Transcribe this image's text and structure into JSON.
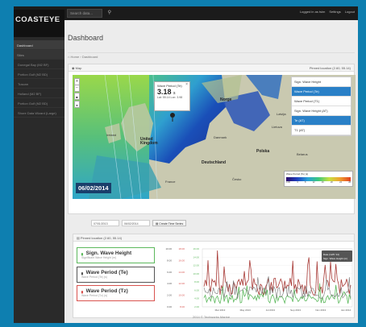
{
  "brand": {
    "name": "COASTEYE"
  },
  "topbar": {
    "search_placeholder": "Search data...",
    "user": "Logged in as tsim",
    "settings": "Settings",
    "logout": "Logout"
  },
  "sidebar": {
    "items": [
      {
        "label": "Dashboard",
        "active": true
      },
      {
        "label": "Sites",
        "active": false
      },
      {
        "label": "Donegal Bay (M2 BF)"
      },
      {
        "label": "Portion Gulf (M2 BD)"
      },
      {
        "label": "Tuscan"
      },
      {
        "label": "Holland (M2 BF)"
      },
      {
        "label": "Portion Gulf (M2 BD)"
      },
      {
        "label": "Shore Data Wizard (Large)"
      }
    ]
  },
  "page": {
    "title": "Dashboard",
    "breadcrumb_home": "Home",
    "breadcrumb_current": "Dashboard"
  },
  "map_panel": {
    "title": "Map",
    "right_label": "Pinned location (2.60, 55.14)",
    "zoom_in": "+",
    "zoom_out": "−",
    "popup": {
      "title": "Wave Period (Te)",
      "value": "3.18",
      "unit": "s",
      "lat_lon": "Lat: 55.14 Lon: 3.98"
    },
    "layers": [
      {
        "label": "Sign. Wave Height",
        "selected": false
      },
      {
        "label": "Wave Period (Te)",
        "selected": true
      },
      {
        "label": "Wave Period (T1)",
        "selected": false
      },
      {
        "label": "Sign. Wave Height (AT)",
        "selected": false
      },
      {
        "label": "Te (AT)",
        "selected": true
      },
      {
        "label": "T1 (AT)",
        "selected": false
      }
    ],
    "legend": {
      "title": "Wave Period (Te) [s]",
      "ticks": [
        "0.00",
        "4",
        "8",
        "12",
        "16",
        "20",
        "24",
        "28"
      ]
    },
    "date": "06/02/2014",
    "place_labels": [
      {
        "text": "Norge",
        "big": true
      },
      {
        "text": "Danmark",
        "big": false
      },
      {
        "text": "United Kingdom",
        "big": true
      },
      {
        "text": "Ireland",
        "big": false
      },
      {
        "text": "France",
        "big": false
      },
      {
        "text": "Deutschland",
        "big": true
      },
      {
        "text": "Polska",
        "big": true
      },
      {
        "text": "Česko",
        "big": false
      },
      {
        "text": "Latvija",
        "big": false
      },
      {
        "text": "Lietuva",
        "big": false
      },
      {
        "text": "Belarus",
        "big": false
      },
      {
        "text": "Україна",
        "big": false
      }
    ]
  },
  "date_range": {
    "from": "07/01/2013",
    "to": "06/02/2014",
    "button": "Create Time Series"
  },
  "plot_panel": {
    "title": "Pinned location (2.60, 55.14)",
    "metrics": [
      {
        "title": "Sign. Wave Height",
        "subtitle": "Significant Wave Height (m)",
        "color": "#5cb85c"
      },
      {
        "title": "Wave Period (Te)",
        "subtitle": "Wave Period (Te) (s)",
        "color": "#555555"
      },
      {
        "title": "Wave Period (Tz)",
        "subtitle": "Wave Period (Tz) (s)",
        "color": "#d9534f"
      }
    ],
    "axes_left": [
      "10.00",
      "8.00",
      "6.00",
      "4.00",
      "2.00",
      "0.00"
    ],
    "axes_mid": [
      "18.00",
      "16.00",
      "14.00",
      "12.00",
      "10.00",
      "8.00"
    ],
    "axes_right": [
      "16.00",
      "14.00",
      "12.00",
      "10.00",
      "8.00",
      "6.00",
      "4.00",
      "2.00"
    ],
    "x_ticks": [
      "Mar 2013",
      "May 2013",
      "Jul 2013",
      "Sep 2013",
      "Nov 2013",
      "Jan 2014"
    ],
    "tooltip": {
      "line1": "Date (12/6 '14)",
      "line2": "Sign. Wave Height (m)"
    }
  },
  "footer": "2014 © Techworks Marine",
  "colors": {
    "accent": "#2a80c7",
    "green": "#5cb85c",
    "red": "#d9534f"
  }
}
